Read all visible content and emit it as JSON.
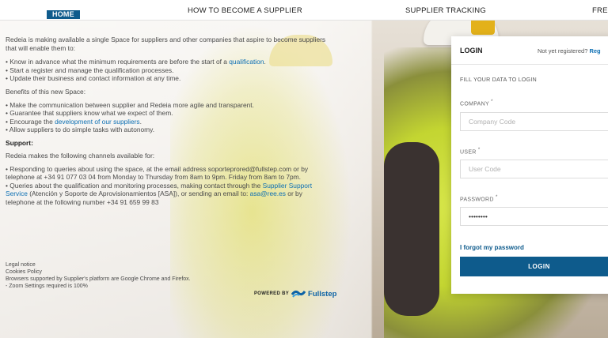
{
  "nav": {
    "items": [
      {
        "label": "HOME"
      },
      {
        "label": "HOW TO BECOME A SUPPLIER"
      },
      {
        "label": "SUPPLIER TRACKING"
      },
      {
        "label": "FREQ"
      }
    ]
  },
  "intro": {
    "lead": "Redeia is making available a single Space for suppliers and other companies that aspire to become suppliers that will enable them to:",
    "points": [
      {
        "text": "Know in advance what the minimum requirements are before the start of a ",
        "link": "qualification",
        "after": "."
      },
      {
        "text": "Start a register and manage the qualification processes.",
        "link": "",
        "after": ""
      },
      {
        "text": "Update their business and contact information at any time.",
        "link": "",
        "after": ""
      }
    ],
    "benefits_title": "Benefits of this new Space:",
    "benefits": [
      {
        "text": "Make the communication between supplier and Redeia more agile and transparent.",
        "link": "",
        "after": ""
      },
      {
        "text": "Guarantee that suppliers know what we expect of them.",
        "link": "",
        "after": ""
      },
      {
        "text": "Encourage the ",
        "link": "development of our suppliers",
        "after": "."
      },
      {
        "text": "Allow suppliers to do simple tasks with autonomy.",
        "link": "",
        "after": ""
      }
    ]
  },
  "support": {
    "title": "Support:",
    "lead": "Redeia makes the following channels available for:",
    "line1_pre": "Responding to queries about using the space, at the email address ",
    "line1_email": "soporteprored@fullstep.com",
    "line1_post": " or by telephone at +34 91 077 03 04 from Monday to Thursday from 8am to 9pm. Friday from 8am to 7pm.",
    "line2_pre": "Queries about the qualification and monitoring processes, making contact through the ",
    "line2_link": "Supplier Support Service",
    "line2_mid": " (Atención y Soporte de Aprovisionamientos [ASA]), or sending an email to: ",
    "line2_email": "asa@ree.es",
    "line2_post": " or by telephone at the following number +34 91 659 99 83"
  },
  "footer": {
    "legal": "Legal notice",
    "cookies": "Cookies Policy",
    "browsers": "Browsers supported by Supplier's platform are Google Chrome and Firefox.",
    "zoom": "- Zoom Settings required is 100%",
    "powered_by": "POWERED BY",
    "brand": "Fullstep"
  },
  "login": {
    "title": "LOGIN",
    "register_text": "Not yet registered?",
    "register_link": "Reg",
    "fill_label": "FILL YOUR DATA TO LOGIN",
    "company_label": "COMPANY",
    "company_placeholder": "Company Code",
    "user_label": "USER",
    "user_placeholder": "User Code",
    "password_label": "PASSWORD",
    "password_value": "••••••••",
    "forgot": "I forgot my password",
    "button": "LOGIN",
    "required_mark": "*"
  },
  "colors": {
    "accent": "#0e5b8c",
    "link": "#0e70b4"
  }
}
